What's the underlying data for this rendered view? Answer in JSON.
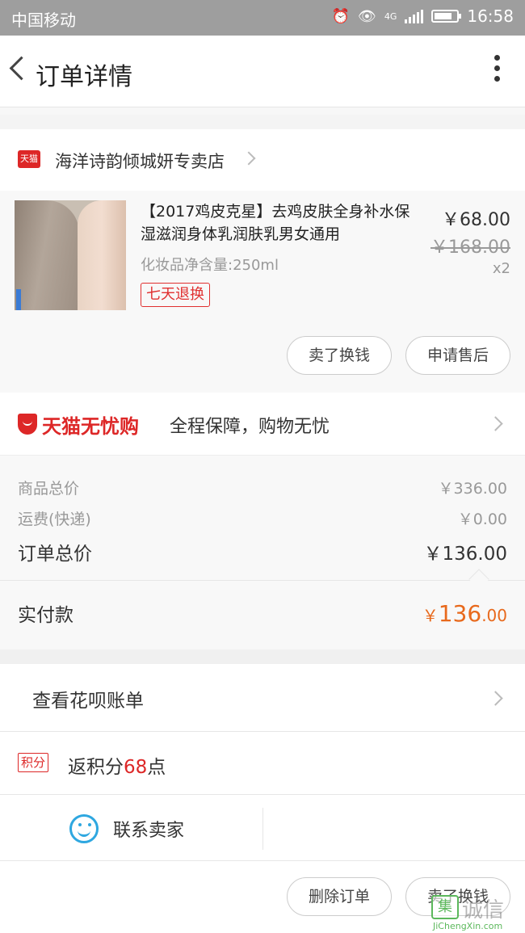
{
  "status_bar": {
    "carrier": "中国移动",
    "time": "16:58",
    "network": "4G"
  },
  "nav": {
    "title": "订单详情"
  },
  "store": {
    "logo_text": "天猫",
    "name": "海洋诗韵倾城妍专卖店"
  },
  "product": {
    "name": "【2017鸡皮克星】去鸡皮肤全身补水保湿滋润身体乳润肤乳男女通用",
    "spec": "化妆品净含量:250ml",
    "badge": "七天退换",
    "price": "￥68.00",
    "original_price": "￥168.00",
    "quantity": "x2",
    "buttons": {
      "sell": "卖了换钱",
      "after_sale": "申请售后"
    }
  },
  "guarantee": {
    "brand": "天猫无忧购",
    "slogan": "全程保障，购物无忧"
  },
  "totals": {
    "goods_label": "商品总价",
    "goods_value": "￥336.00",
    "shipping_label": "运费(快递)",
    "shipping_value": "￥0.00",
    "order_label": "订单总价",
    "order_value": "￥136.00",
    "paid_label": "实付款",
    "paid_currency": "￥",
    "paid_int": "136",
    "paid_dec": ".00"
  },
  "huabei": {
    "label": "查看花呗账单"
  },
  "points": {
    "tag": "积分",
    "prefix": "返积分",
    "value": "68",
    "suffix": "点"
  },
  "contact": {
    "label": "联系卖家"
  },
  "bottom": {
    "delete_label": "删除订单",
    "sell_label": "卖了换钱"
  },
  "watermark": {
    "mark": "集",
    "cn": "诚信",
    "en": "JiChengXin.com"
  },
  "colors": {
    "tmall_red": "#dd2727",
    "paid_orange": "#e8691c",
    "contact_blue": "#2ea7e0",
    "status_bar": "#9e9e9e"
  }
}
